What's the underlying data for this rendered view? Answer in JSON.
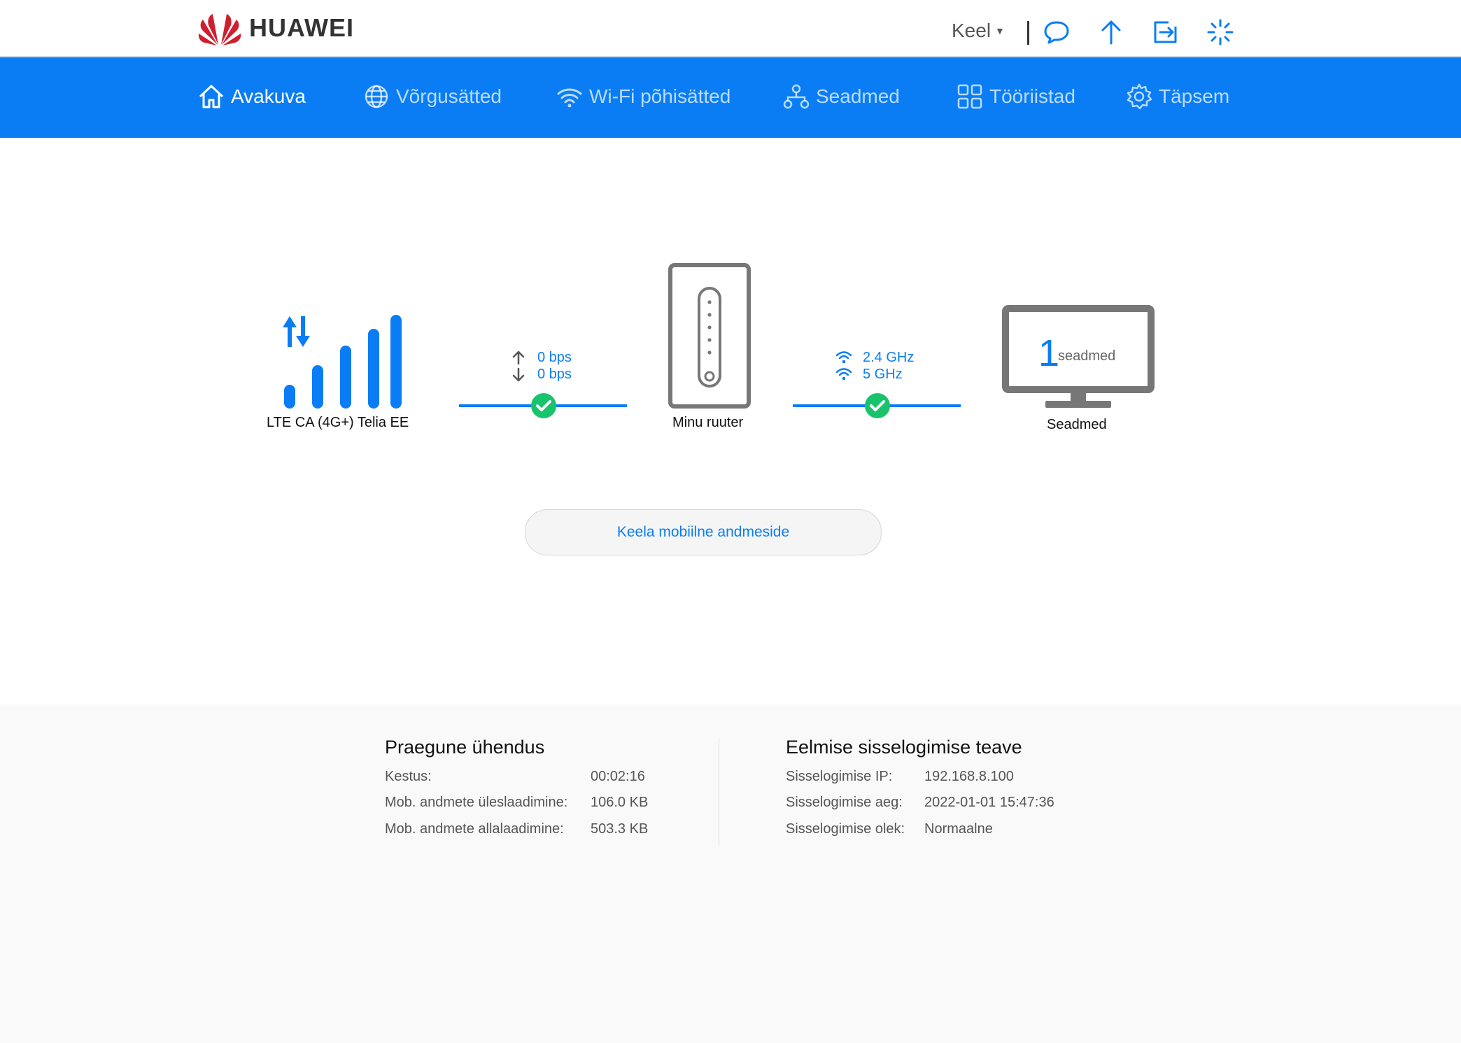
{
  "header": {
    "brand": "HUAWEI",
    "language_label": "Keel",
    "icons": [
      "chat-icon",
      "upload-arrow-icon",
      "logout-icon",
      "loading-spinner-icon"
    ]
  },
  "nav": {
    "items": [
      {
        "label": "Avakuva",
        "icon": "home-icon",
        "active": true
      },
      {
        "label": "Võrgusätted",
        "icon": "globe-icon",
        "active": false
      },
      {
        "label": "Wi-Fi põhisätted",
        "icon": "wifi-icon",
        "active": false
      },
      {
        "label": "Seadmed",
        "icon": "network-devices-icon",
        "active": false
      },
      {
        "label": "Tööriistad",
        "icon": "tools-grid-icon",
        "active": false
      },
      {
        "label": "Täpsem",
        "icon": "gear-icon",
        "active": false
      }
    ]
  },
  "diagram": {
    "network_label": "LTE CA (4G+) Telia EE",
    "upload_rate": "0 bps",
    "download_rate": "0 bps",
    "router_label": "Minu ruuter",
    "band_24": "2.4 GHz",
    "band_5": "5 GHz",
    "device_count": "1",
    "device_count_unit": "seadmed",
    "devices_label": "Seadmed"
  },
  "actions": {
    "disable_mobile_data": "Keela mobiilne andmeside"
  },
  "current_connection": {
    "title": "Praegune ühendus",
    "rows": [
      {
        "label": "Kestus:",
        "value": "00:02:16"
      },
      {
        "label": "Mob. andmete üleslaadimine:",
        "value": "106.0 KB"
      },
      {
        "label": "Mob. andmete allalaadimine:",
        "value": "503.3 KB"
      }
    ]
  },
  "last_login": {
    "title": "Eelmise sisselogimise teave",
    "rows": [
      {
        "label": "Sisselogimise IP:",
        "value": "192.168.8.100"
      },
      {
        "label": "Sisselogimise aeg:",
        "value": "2022-01-01 15:47:36"
      },
      {
        "label": "Sisselogimise olek:",
        "value": "Normaalne"
      }
    ]
  },
  "colors": {
    "accent": "#0a7df5",
    "success": "#19c36b",
    "device_gray": "#777777",
    "brand_red": "#cf1f2e"
  }
}
